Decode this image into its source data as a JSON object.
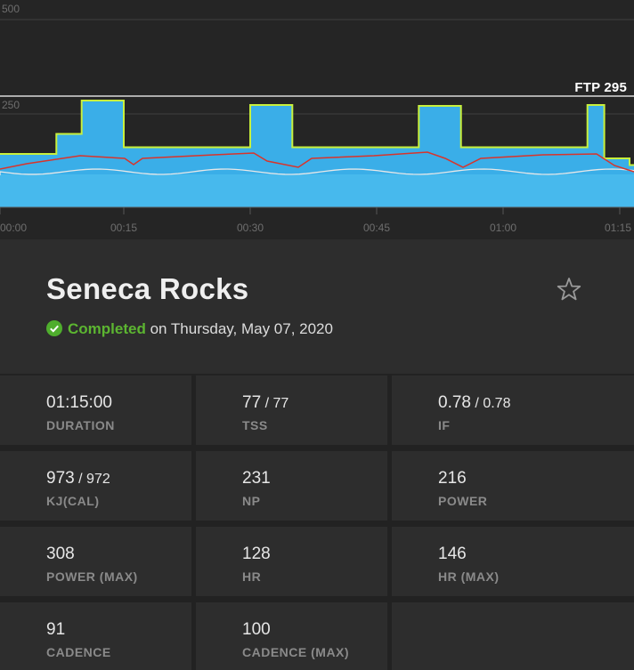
{
  "chart": {
    "y_ticks": [
      "500",
      "250"
    ],
    "x_ticks": [
      "00:00",
      "00:15",
      "00:30",
      "00:45",
      "01:00",
      "01:15"
    ],
    "ftp_label": "FTP 295",
    "colors": {
      "power_fill": "#3aaee8",
      "power_outline": "#c8f03c",
      "heart_rate": "#d9342b",
      "cadence": "#e8e8e8",
      "ftp_line": "#ffffff"
    }
  },
  "chart_data": {
    "type": "area",
    "xlabel": "",
    "ylabel": "",
    "x_ticks": [
      "00:00",
      "00:15",
      "00:30",
      "00:45",
      "01:00",
      "01:15"
    ],
    "y_ticks": [
      250,
      500
    ],
    "reference_line": {
      "label": "FTP 295",
      "value": 295
    },
    "series": [
      {
        "key": "power",
        "x_min": [
          0,
          3,
          7,
          10,
          15,
          30,
          35,
          50,
          55,
          70,
          72,
          75
        ],
        "y": [
          120,
          120,
          165,
          240,
          135,
          230,
          135,
          228,
          135,
          230,
          110,
          95
        ]
      }
    ]
  },
  "workout": {
    "title": "Seneca Rocks",
    "status": "Completed",
    "date_text": "on Thursday, May 07, 2020"
  },
  "metrics": [
    {
      "value": "01:15:00",
      "sub": "",
      "label": "DURATION"
    },
    {
      "value": "77",
      "sub": " / 77",
      "label": "TSS"
    },
    {
      "value": "0.78",
      "sub": " / 0.78",
      "label": "IF"
    },
    {
      "value": "973",
      "sub": " / 972",
      "label": "KJ(CAL)"
    },
    {
      "value": "231",
      "sub": "",
      "label": "NP"
    },
    {
      "value": "216",
      "sub": "",
      "label": "POWER"
    },
    {
      "value": "308",
      "sub": "",
      "label": "POWER (MAX)"
    },
    {
      "value": "128",
      "sub": "",
      "label": "HR"
    },
    {
      "value": "146",
      "sub": "",
      "label": "HR (MAX)"
    },
    {
      "value": "91",
      "sub": "",
      "label": "CADENCE"
    },
    {
      "value": "100",
      "sub": "",
      "label": "CADENCE (MAX)"
    }
  ]
}
